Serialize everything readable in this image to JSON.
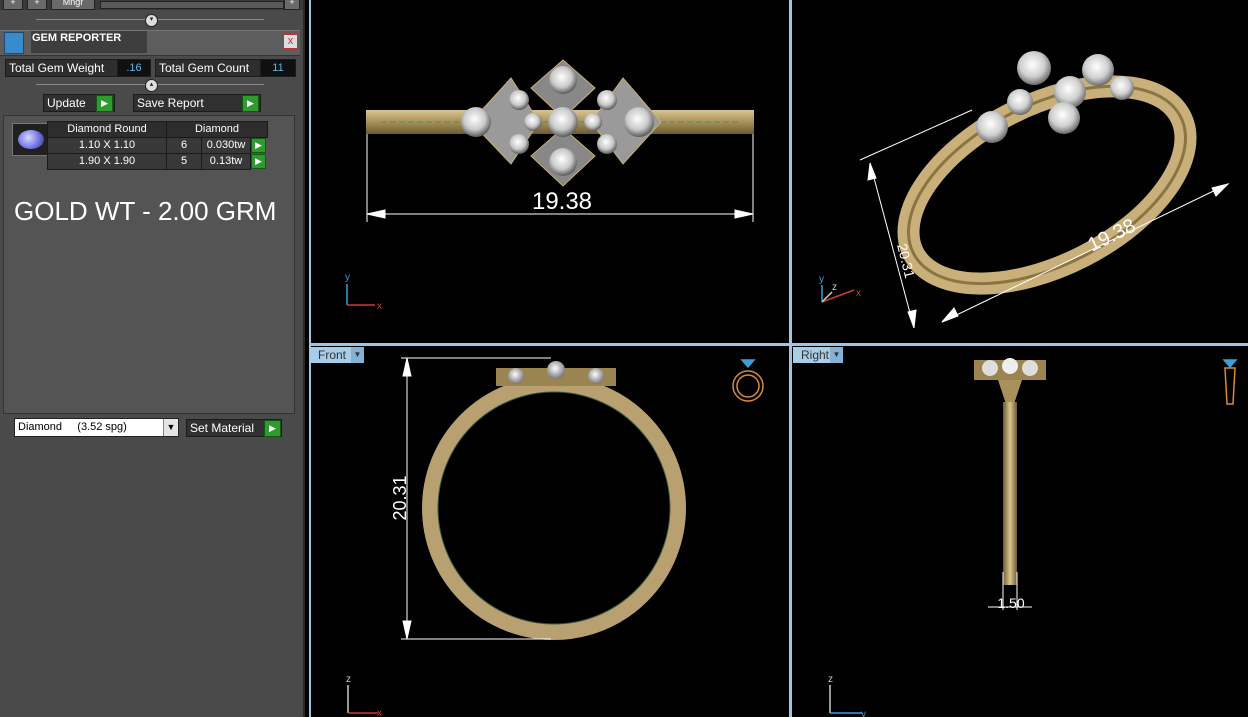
{
  "toolbar": {
    "btn1": "+",
    "btn2": "+",
    "btn3": "Mngr",
    "btn4": "+"
  },
  "gem_reporter": {
    "title": "GEM REPORTER",
    "close": "x",
    "total_weight_label": "Total Gem Weight",
    "total_weight_value": ".16",
    "total_count_label": "Total Gem Count",
    "total_count_value": "11",
    "update_label": "Update",
    "save_label": "Save Report",
    "table": {
      "headers": [
        "Diamond Round",
        "Diamond"
      ],
      "rows": [
        {
          "size": "1.10 X 1.10",
          "count": "6",
          "weight": "0.030tw"
        },
        {
          "size": "1.90 X 1.90",
          "count": "5",
          "weight": "0.13tw"
        }
      ]
    },
    "gold_weight": "GOLD WT - 2.00 GRM",
    "material_value": "Diamond     (3.52 spg)",
    "set_material_label": "Set Material"
  },
  "viewports": {
    "top": {
      "dimension": "19.38"
    },
    "perspective": {
      "dimension1": "19.38",
      "dimension2": "20.31"
    },
    "front": {
      "tab": "Front",
      "dimension": "20.31"
    },
    "right": {
      "tab": "Right",
      "dimension": "1.50"
    }
  },
  "axes": {
    "x": "x",
    "y": "y",
    "z": "z"
  },
  "colors": {
    "gold": "#c9b07a",
    "dim_line": "#ffffff",
    "axis_x": "#d03a2a",
    "axis_y": "#3aa0d8",
    "axis_z": "#cccccc",
    "viewport_border": "#9cc6e6"
  }
}
